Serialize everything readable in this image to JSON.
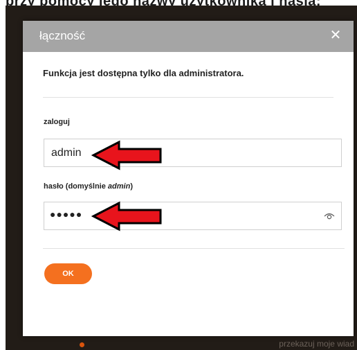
{
  "background": {
    "top_text": "przy pomocy jego nazwy uzytkownika i hasla:",
    "bottom_text": "przekazuj moje wiad"
  },
  "dialog": {
    "title": "łączność",
    "close_symbol": "✕",
    "notice": "Funkcja jest dostępna tylko dla administratora.",
    "login": {
      "label": "zaloguj",
      "value": "admin"
    },
    "password": {
      "label_prefix": "hasło (domyślnie ",
      "label_emphasis": "admin",
      "label_suffix": ")",
      "masked_value": "●●●●●",
      "toggle_icon": "eye-icon"
    },
    "ok_label": "OK"
  },
  "colors": {
    "header": "#a5a5a5",
    "accent": "#f4701f",
    "arrow": "#e8141c",
    "backdrop": "#221c17"
  }
}
